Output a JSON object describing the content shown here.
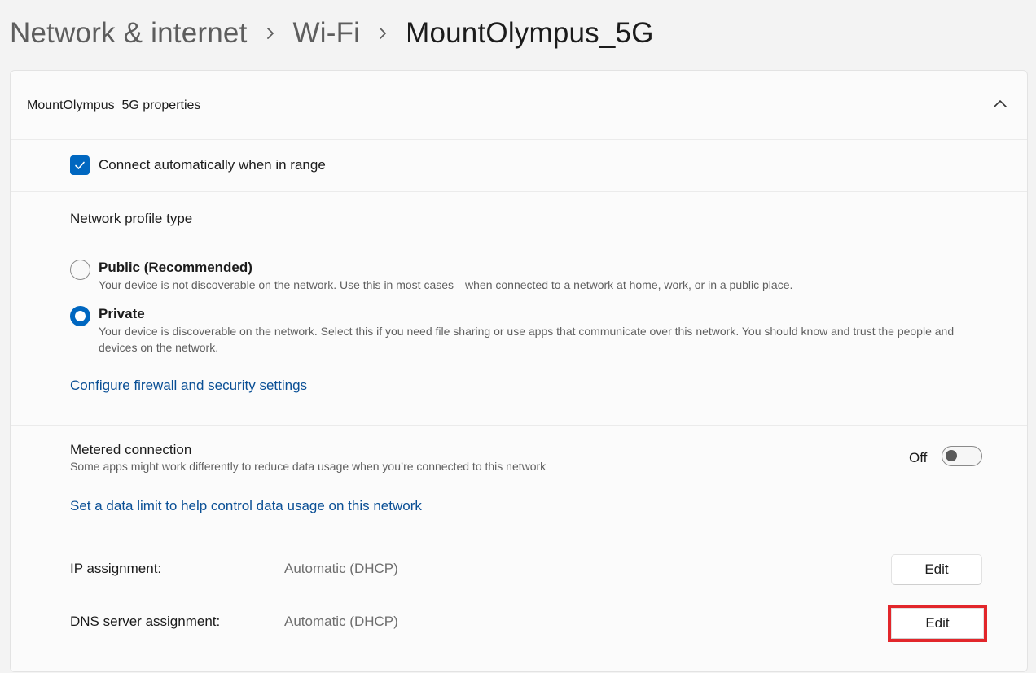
{
  "breadcrumb": {
    "items": [
      "Network & internet",
      "Wi-Fi"
    ],
    "current": "MountOlympus_5G"
  },
  "properties": {
    "title": "MountOlympus_5G properties",
    "collapse_icon": "chevron-up-icon"
  },
  "auto_connect": {
    "label": "Connect automatically when in range",
    "checked": true
  },
  "profile": {
    "title": "Network profile type",
    "options": [
      {
        "label": "Public (Recommended)",
        "description": "Your device is not discoverable on the network. Use this in most cases—when connected to a network at home, work, or in a public place.",
        "selected": false
      },
      {
        "label": "Private",
        "description": "Your device is discoverable on the network. Select this if you need file sharing or use apps that communicate over this network. You should know and trust the people and devices on the network.",
        "selected": true
      }
    ],
    "firewall_link": "Configure firewall and security settings"
  },
  "metered": {
    "title": "Metered connection",
    "description": "Some apps might work differently to reduce data usage when you’re connected to this network",
    "state_label": "Off",
    "enabled": false,
    "data_limit_link": "Set a data limit to help control data usage on this network"
  },
  "ip_assignment": {
    "label": "IP assignment:",
    "value": "Automatic (DHCP)",
    "button": "Edit"
  },
  "dns_assignment": {
    "label": "DNS server assignment:",
    "value": "Automatic (DHCP)",
    "button": "Edit",
    "highlight_color": "#e2262b"
  },
  "colors": {
    "accent": "#0067c0",
    "link": "#0a4f95"
  }
}
